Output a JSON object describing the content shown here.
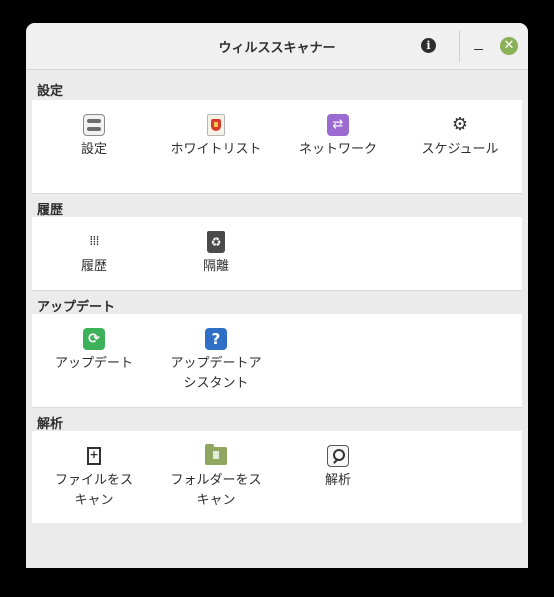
{
  "window": {
    "title": "ウィルススキャナー"
  },
  "titlebar": {
    "info_icon": "info-icon",
    "minimize_icon": "minimize-icon",
    "close_icon": "close-icon",
    "close_color": "#8bb158"
  },
  "sections": [
    {
      "title": "設定",
      "items": [
        {
          "label": "設定",
          "icon": "settings-icon"
        },
        {
          "label": "ホワイトリスト",
          "icon": "whitelist-icon"
        },
        {
          "label": "ネットワーク",
          "icon": "network-icon"
        },
        {
          "label": "スケジュール",
          "icon": "gear-icon"
        }
      ]
    },
    {
      "title": "履歴",
      "items": [
        {
          "label": "履歴",
          "icon": "history-icon"
        },
        {
          "label": "隔離",
          "icon": "trash-icon"
        }
      ]
    },
    {
      "title": "アップデート",
      "items": [
        {
          "label": "アップデート",
          "icon": "update-icon"
        },
        {
          "label_line1": "アップデートア",
          "label_line2": "シスタント",
          "icon": "help-icon"
        }
      ]
    },
    {
      "title": "解析",
      "items": [
        {
          "label_line1": "ファイルをス",
          "label_line2": "キャン",
          "icon": "file-icon"
        },
        {
          "label_line1": "フォルダーをス",
          "label_line2": "キャン",
          "icon": "folder-icon"
        },
        {
          "label": "解析",
          "icon": "analyze-icon"
        }
      ]
    }
  ]
}
